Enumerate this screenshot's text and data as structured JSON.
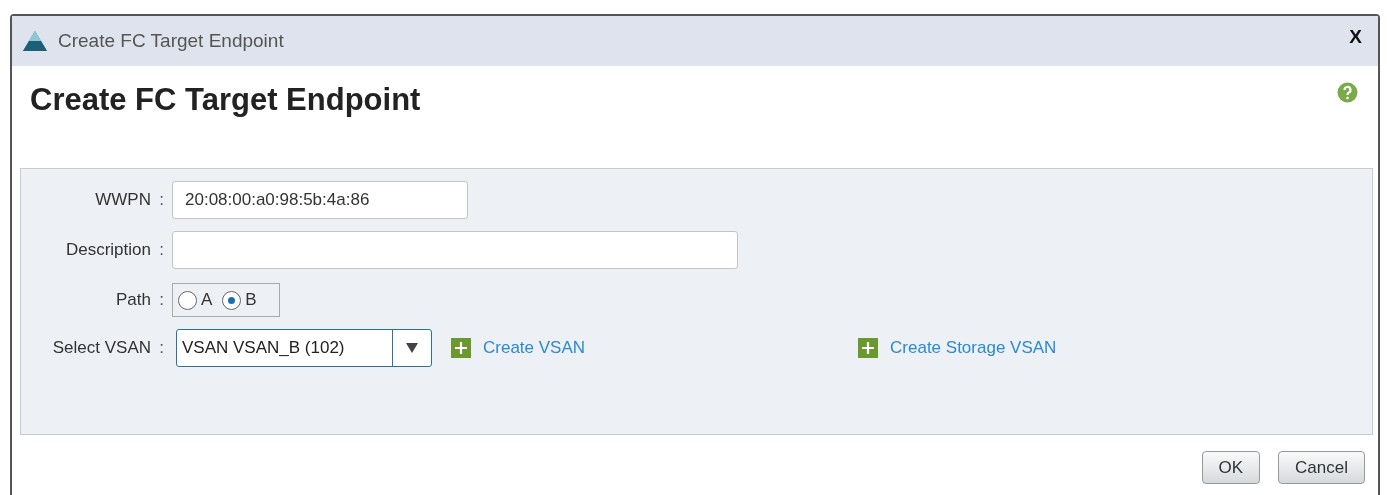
{
  "window": {
    "title": "Create FC Target Endpoint",
    "close": "X"
  },
  "heading": "Create FC Target Endpoint",
  "form": {
    "fields": [
      {
        "kind": "text",
        "label": "WWPN",
        "separator": ":",
        "value": "20:08:00:a0:98:5b:4a:86"
      },
      {
        "kind": "text",
        "label": "Description",
        "separator": ":"
      },
      {
        "kind": "radio",
        "label": "Path",
        "separator": ":",
        "options": [
          {
            "label": "A",
            "selected": false
          },
          {
            "label": "B",
            "selected": true
          }
        ]
      },
      {
        "kind": "select",
        "label": "Select VSAN",
        "separator": ":",
        "value": "VSAN VSAN_B (102)",
        "links": [
          "Create VSAN",
          "Create Storage VSAN"
        ]
      }
    ]
  },
  "buttons": [
    "OK",
    "Cancel"
  ]
}
